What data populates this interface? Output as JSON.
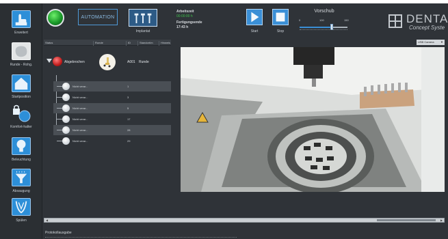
{
  "sidebar": {
    "items": [
      {
        "label": "Erweitert",
        "icon": "hand-pointer-icon"
      },
      {
        "label": "Runde - Rohg.",
        "icon": "blank-disc-icon"
      },
      {
        "label": "Startposition",
        "icon": "home-icon"
      },
      {
        "label": "Komfort-halter",
        "icon": "lock-holder-icon"
      },
      {
        "label": "Beleuchtung",
        "icon": "lightbulb-icon"
      },
      {
        "label": "Absaugung",
        "icon": "suction-funnel-icon"
      },
      {
        "label": "Spülen",
        "icon": "rinse-icon"
      }
    ]
  },
  "topbar": {
    "automation_label": "AUTOMATION",
    "implant_label": "Implantat",
    "work_time_label": "Arbeitszeit",
    "work_time_value": "00:00:00 h",
    "finish_label": "Fertigungsende",
    "finish_value": "17:43 h",
    "start_label": "Start",
    "stop_label": "Stop",
    "feed": {
      "title": "Vorschub",
      "min": "0",
      "current": "100",
      "max": "150",
      "fraction": 0.67
    },
    "logo_name": "DENTA",
    "logo_sub": "Concept Syste"
  },
  "table": {
    "headers": [
      "Status",
      "Runde",
      "ID",
      "Standort/m",
      "Hinweis"
    ],
    "parent": {
      "status": "Abgebrochen",
      "id": "A001",
      "shape": "Runde"
    },
    "children": [
      {
        "status": "Nicht verar...",
        "id": "1"
      },
      {
        "status": "Nicht verar...",
        "id": "3"
      },
      {
        "status": "Nicht verar...",
        "id": "5"
      },
      {
        "status": "Nicht verar...",
        "id": "17"
      },
      {
        "status": "Nicht verar...",
        "id": "28"
      },
      {
        "status": "Nicht verar...",
        "id": "29"
      }
    ]
  },
  "camera": {
    "selected": "USB Camera"
  },
  "footer": {
    "log_label": "Protokollausgabe"
  },
  "colors": {
    "accent": "#3a8fd6",
    "ok": "#3ec04b",
    "alert": "#c01d1d",
    "panel": "#2f3338"
  }
}
